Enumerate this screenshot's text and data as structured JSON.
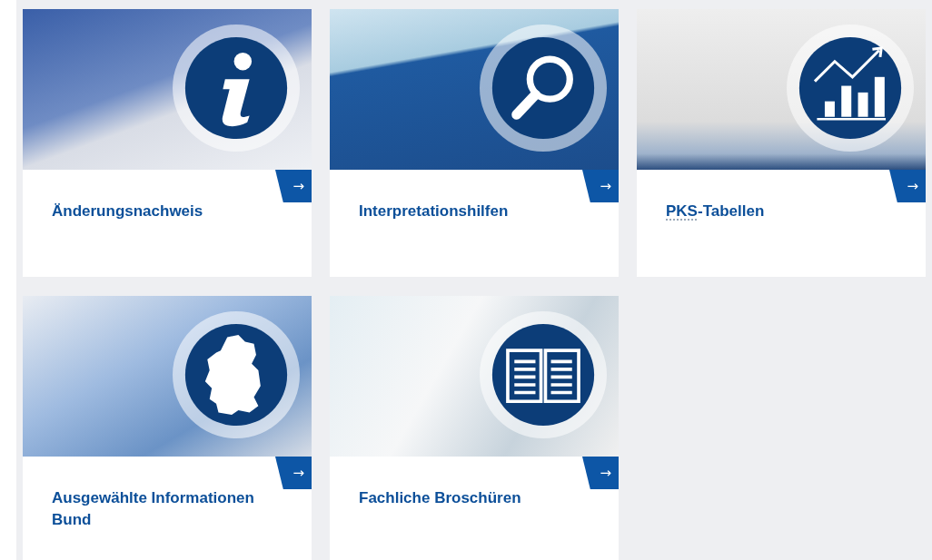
{
  "cards": [
    {
      "kind": "info",
      "arrow": "→",
      "title_parts": [
        {
          "text": "Änderungsnachweis",
          "abbr": false
        }
      ]
    },
    {
      "kind": "search",
      "arrow": "→",
      "title_parts": [
        {
          "text": "Interpretationshilfen",
          "abbr": false
        }
      ]
    },
    {
      "kind": "chart",
      "arrow": "→",
      "title_parts": [
        {
          "text": "PKS",
          "abbr": true
        },
        {
          "text": "-Tabellen",
          "abbr": false
        }
      ]
    },
    {
      "kind": "map",
      "arrow": "→",
      "title_parts": [
        {
          "text": "Ausgewählte Informationen Bund",
          "abbr": false
        }
      ]
    },
    {
      "kind": "brochure",
      "arrow": "→",
      "title_parts": [
        {
          "text": "Fachliche Broschüren",
          "abbr": false
        }
      ]
    }
  ]
}
